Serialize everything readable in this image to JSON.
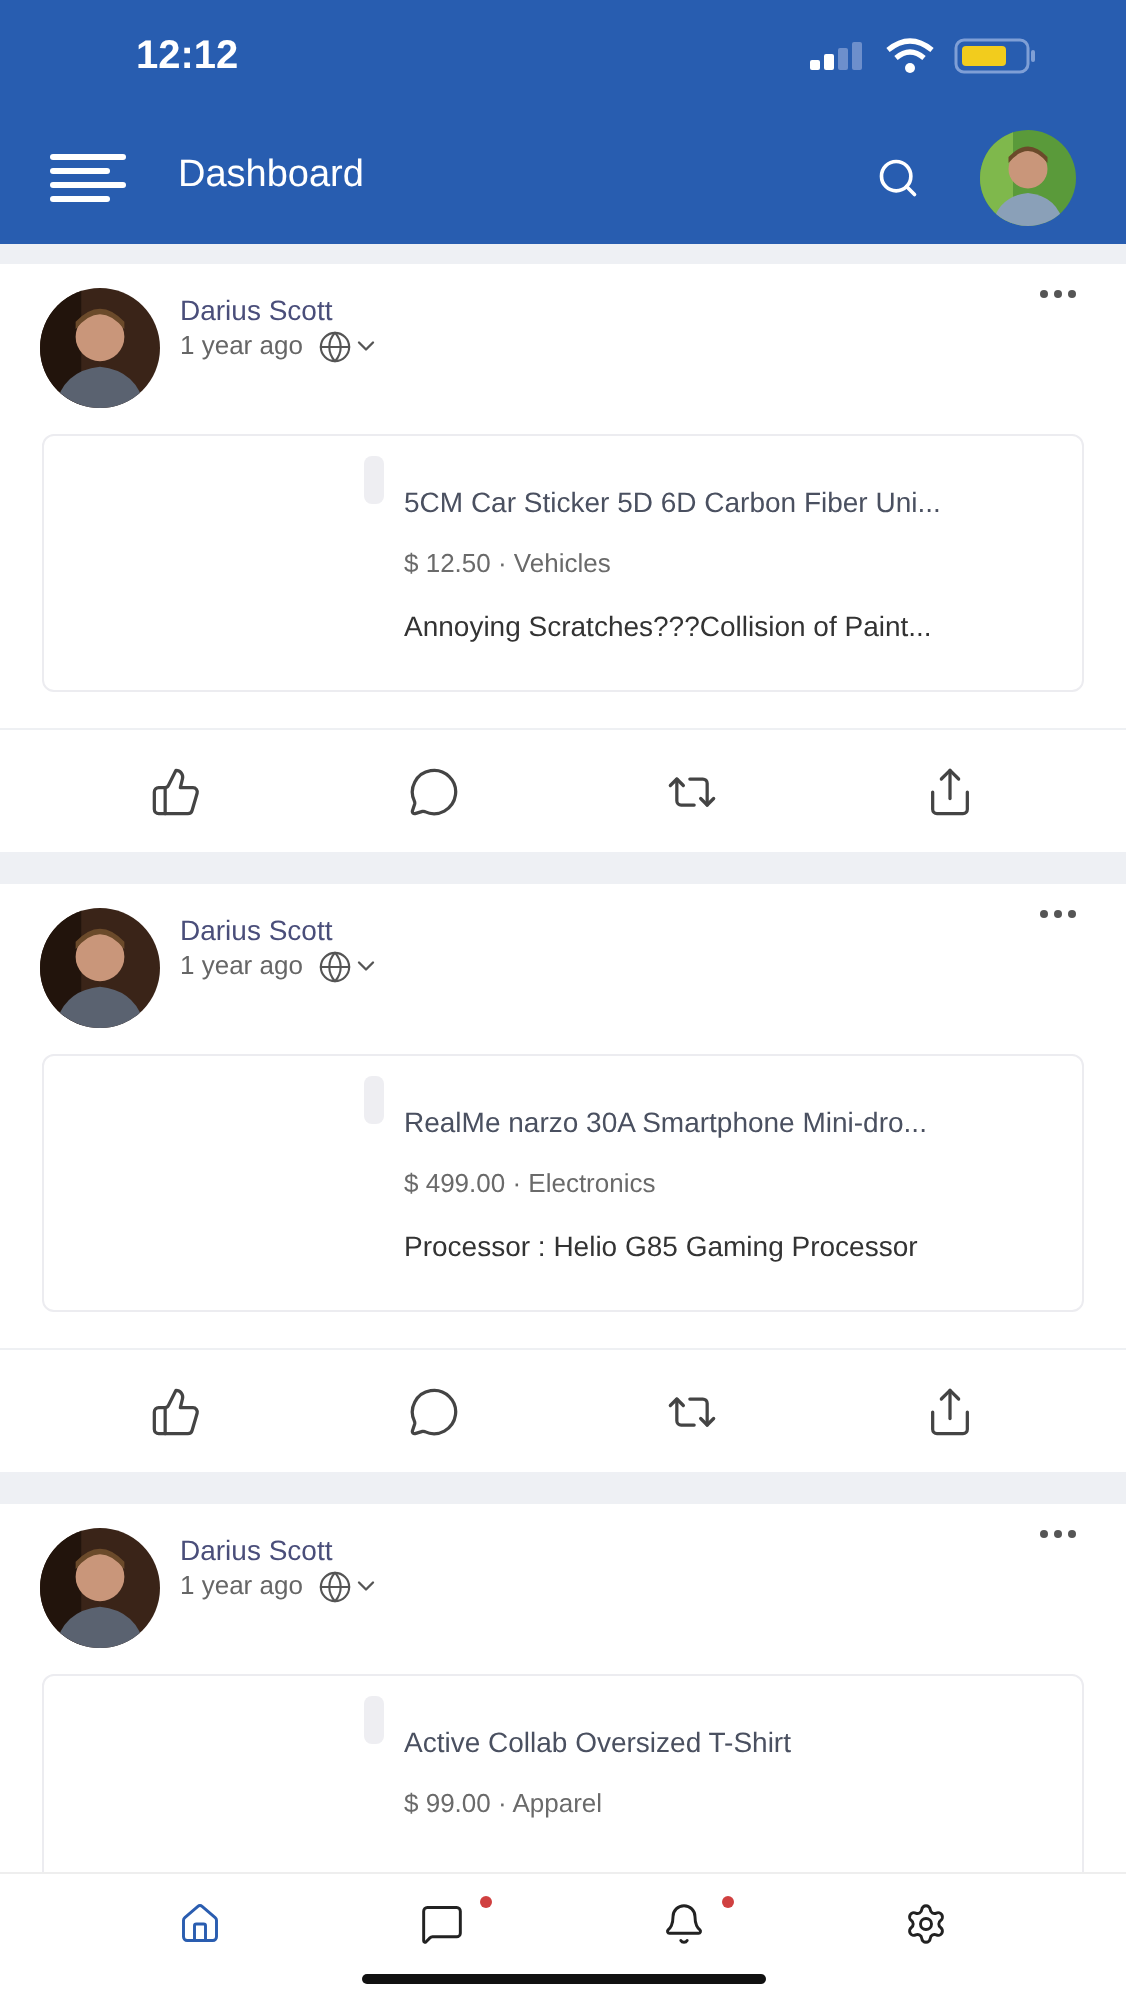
{
  "status_bar": {
    "time": "12:12"
  },
  "app_bar": {
    "title": "Dashboard"
  },
  "posts": [
    {
      "author": "Darius Scott",
      "time": "1 year ago",
      "product": {
        "title": "5CM Car Sticker 5D 6D Carbon Fiber Uni...",
        "meta": "$ 12.50 · Vehicles",
        "description": "Annoying Scratches???Collision of Paint..."
      }
    },
    {
      "author": "Darius Scott",
      "time": "1 year ago",
      "product": {
        "title": "RealMe narzo 30A Smartphone Mini-dro...",
        "meta": "$ 499.00 · Electronics",
        "description": "Processor : Helio G85 Gaming Processor"
      }
    },
    {
      "author": "Darius Scott",
      "time": "1 year ago",
      "product": {
        "title": "Active Collab Oversized T-Shirt",
        "meta": "$ 99.00 · Apparel"
      }
    }
  ],
  "bottom_nav": [
    {
      "kind": "home",
      "selected": true,
      "badge": false
    },
    {
      "kind": "chat",
      "selected": false,
      "badge": true
    },
    {
      "kind": "bell",
      "selected": false,
      "badge": true
    },
    {
      "kind": "settings",
      "selected": false,
      "badge": false
    }
  ]
}
